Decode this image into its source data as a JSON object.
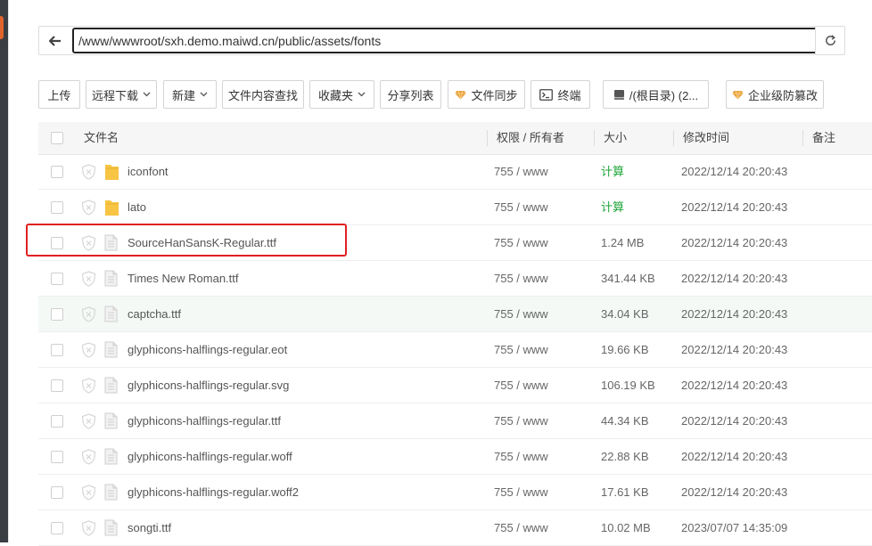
{
  "path": {
    "value": "/www/wwwroot/sxh.demo.maiwd.cn/public/assets/fonts"
  },
  "toolbar": {
    "upload": "上传",
    "remote_download": "远程下载",
    "new": "新建",
    "content_search": "文件内容查找",
    "favorites": "收藏夹",
    "share_list": "分享列表",
    "file_sync": "文件同步",
    "terminal": "终端",
    "disk": "/(根目录) (2...",
    "enterprise_tamper": "企业级防篡改"
  },
  "table": {
    "headers": {
      "name": "文件名",
      "perm_owner": "权限 / 所有者",
      "size": "大小",
      "mtime": "修改时间",
      "note": "备注"
    },
    "rows": [
      {
        "name": "iconfont",
        "type": "folder",
        "perm": "755 / www",
        "size": "计算",
        "mtime": "2022/12/14 20:20:43"
      },
      {
        "name": "lato",
        "type": "folder",
        "perm": "755 / www",
        "size": "计算",
        "mtime": "2022/12/14 20:20:43"
      },
      {
        "name": "SourceHanSansK-Regular.ttf",
        "type": "file",
        "perm": "755 / www",
        "size": "1.24 MB",
        "mtime": "2022/12/14 20:20:43"
      },
      {
        "name": "Times New Roman.ttf",
        "type": "file",
        "perm": "755 / www",
        "size": "341.44 KB",
        "mtime": "2022/12/14 20:20:43"
      },
      {
        "name": "captcha.ttf",
        "type": "file",
        "perm": "755 / www",
        "size": "34.04 KB",
        "mtime": "2022/12/14 20:20:43"
      },
      {
        "name": "glyphicons-halflings-regular.eot",
        "type": "file",
        "perm": "755 / www",
        "size": "19.66 KB",
        "mtime": "2022/12/14 20:20:43"
      },
      {
        "name": "glyphicons-halflings-regular.svg",
        "type": "file",
        "perm": "755 / www",
        "size": "106.19 KB",
        "mtime": "2022/12/14 20:20:43"
      },
      {
        "name": "glyphicons-halflings-regular.ttf",
        "type": "file",
        "perm": "755 / www",
        "size": "44.34 KB",
        "mtime": "2022/12/14 20:20:43"
      },
      {
        "name": "glyphicons-halflings-regular.woff",
        "type": "file",
        "perm": "755 / www",
        "size": "22.88 KB",
        "mtime": "2022/12/14 20:20:43"
      },
      {
        "name": "glyphicons-halflings-regular.woff2",
        "type": "file",
        "perm": "755 / www",
        "size": "17.61 KB",
        "mtime": "2022/12/14 20:20:43"
      },
      {
        "name": "songti.ttf",
        "type": "file",
        "perm": "755 / www",
        "size": "10.02 MB",
        "mtime": "2023/07/07 14:35:09"
      }
    ]
  },
  "colors": {
    "calc_green": "#20a53a",
    "highlight_red": "#e02020",
    "folder_yellow": "#f7c543",
    "vip_gold": "#e8a33d"
  },
  "icons": {
    "back": "arrow-left-icon",
    "refresh": "refresh-icon",
    "folder": "folder-icon",
    "file": "file-icon",
    "lock": "shield-x-icon",
    "vip": "gem-icon",
    "terminal": "terminal-icon",
    "disk": "disk-icon"
  }
}
